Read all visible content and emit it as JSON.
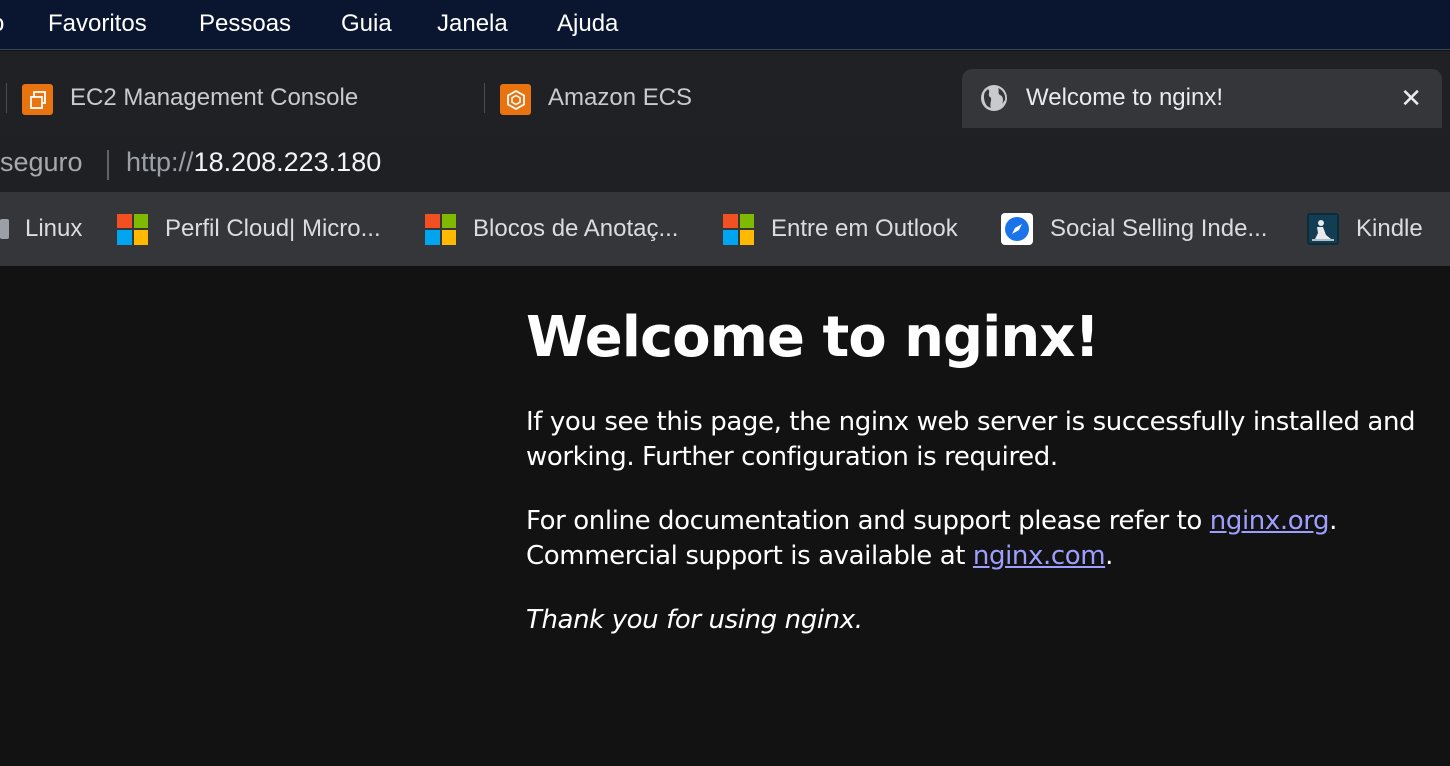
{
  "menubar": {
    "items": [
      "o",
      "Favoritos",
      "Pessoas",
      "Guia",
      "Janela",
      "Ajuda"
    ]
  },
  "tabs": [
    {
      "title": "EC2 Management Console",
      "favicon": "aws-ec2-icon",
      "active": false
    },
    {
      "title": "Amazon ECS",
      "favicon": "aws-ecs-icon",
      "active": false
    },
    {
      "title": "Welcome to nginx!",
      "favicon": "globe-icon",
      "active": true
    }
  ],
  "tab_close_glyph": "✕",
  "omnibox": {
    "security_label": "seguro",
    "url_scheme": "http://",
    "url_host": "18.208.223.180"
  },
  "bookmarks": [
    {
      "label": "Linux",
      "icon": "folder-icon"
    },
    {
      "label": "Perfil Cloud| Micro...",
      "icon": "microsoft-icon"
    },
    {
      "label": "Blocos de Anotaç...",
      "icon": "microsoft-icon"
    },
    {
      "label": "Entre em Outlook",
      "icon": "microsoft-icon"
    },
    {
      "label": "Social Selling Inde...",
      "icon": "compass-icon"
    },
    {
      "label": "Kindle",
      "icon": "kindle-icon"
    }
  ],
  "page": {
    "heading": "Welcome to nginx!",
    "para1": "If you see this page, the nginx web server is successfully installed and working. Further configuration is required.",
    "para2_before": "For online documentation and support please refer to ",
    "para2_link1": "nginx.org",
    "para2_mid": ".",
    "para2_line2": "Commercial support is available at ",
    "para2_link2": "nginx.com",
    "para2_end": ".",
    "para3": "Thank you for using nginx."
  },
  "colors": {
    "menubar_bg": "#0a1630",
    "tabstrip_bg": "#202124",
    "active_tab_bg": "#35363a",
    "aws_orange": "#e8730f",
    "page_bg": "#121212",
    "link": "#9e9eff"
  }
}
